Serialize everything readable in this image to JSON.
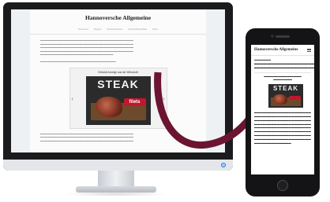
{
  "desktop": {
    "logo": "Hannoversche Allgemeine",
    "nav": [
      "Hannover",
      "Region",
      "Niedersachsen",
      "Deutschland/Welt",
      "Sport"
    ],
    "ad_title": "Editorial Anzeige aus der Wirtschaft",
    "steak_word": "STEAK",
    "steak_tag": "filets"
  },
  "mobile": {
    "logo": "Hannoversche Allgemeine",
    "steak_word": "STEAK"
  },
  "colors": {
    "arrow": "#6b1530",
    "power_led": "#2a7ce0"
  }
}
